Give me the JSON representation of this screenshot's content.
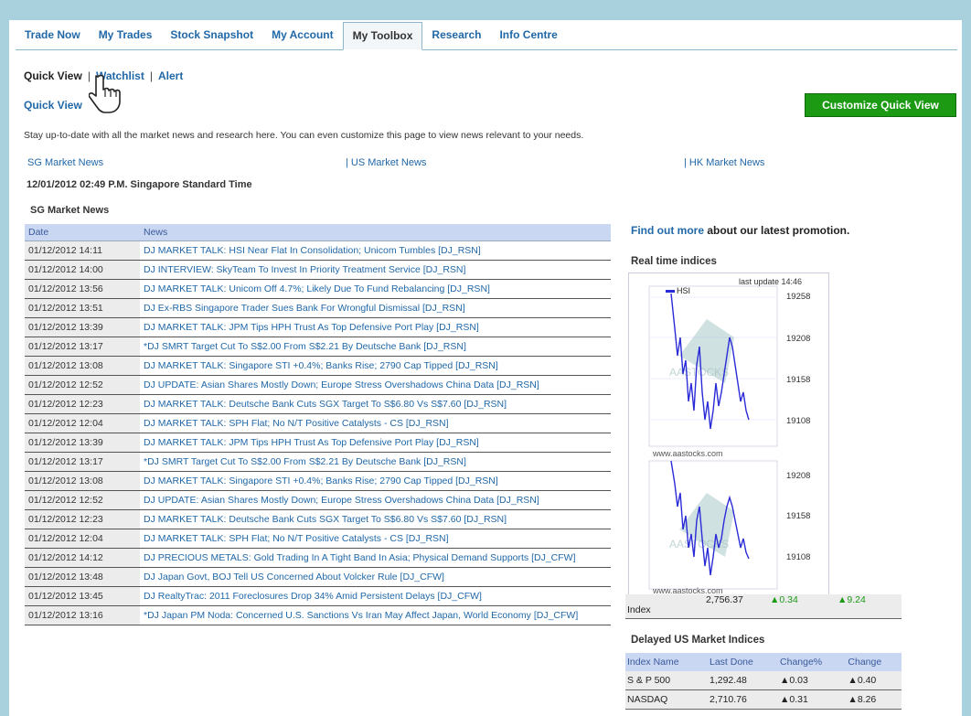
{
  "tabs": [
    {
      "label": "Trade Now"
    },
    {
      "label": "My Trades"
    },
    {
      "label": "Stock Snapshot"
    },
    {
      "label": "My Account"
    },
    {
      "label": "My Toolbox",
      "active": true
    },
    {
      "label": "Research"
    },
    {
      "label": "Info Centre"
    }
  ],
  "subnav": {
    "quick_view": "Quick View",
    "sep": "|",
    "watchlist": "Watchlist",
    "alert": "Alert"
  },
  "page_title": "Quick View",
  "customize_button": "Customize Quick View",
  "intro": "Stay up-to-date with all the market news and research here. You can even customize this page to view news relevant to your needs.",
  "market_links": {
    "sg": "SG Market News",
    "us": "| US Market News",
    "hk": "| HK Market News"
  },
  "timestamp": "12/01/2012 02:49 P.M. Singapore Standard Time",
  "section_label": "SG Market News",
  "news_table": {
    "headers": [
      "Date",
      "News"
    ],
    "rows": [
      [
        "01/12/2012 14:11",
        "DJ MARKET TALK: HSI Near Flat In Consolidation; Unicom Tumbles [DJ_RSN]"
      ],
      [
        "01/12/2012 14:00",
        "DJ INTERVIEW: SkyTeam To Invest In Priority Treatment Service [DJ_RSN]"
      ],
      [
        "01/12/2012 13:56",
        "DJ MARKET TALK: Unicom Off 4.7%; Likely Due To Fund Rebalancing [DJ_RSN]"
      ],
      [
        "01/12/2012 13:51",
        "DJ Ex-RBS Singapore Trader Sues Bank For Wrongful Dismissal [DJ_RSN]"
      ],
      [
        "01/12/2012 13:39",
        "DJ MARKET TALK: JPM Tips HPH Trust As Top Defensive Port Play [DJ_RSN]"
      ],
      [
        "01/12/2012 13:17",
        "*DJ SMRT Target Cut To S$2.00 From S$2.21 By Deutsche Bank [DJ_RSN]"
      ],
      [
        "01/12/2012 13:08",
        "DJ MARKET TALK: Singapore STI +0.4%; Banks Rise; 2790 Cap Tipped [DJ_RSN]"
      ],
      [
        "01/12/2012 12:52",
        "DJ UPDATE: Asian Shares Mostly Down; Europe Stress Overshadows China Data [DJ_RSN]"
      ],
      [
        "01/12/2012 12:23",
        "DJ MARKET TALK: Deutsche Bank Cuts SGX Target To S$6.80 Vs S$7.60 [DJ_RSN]"
      ],
      [
        "01/12/2012 12:04",
        "DJ MARKET TALK: SPH Flat; No N/T Positive Catalysts - CS [DJ_RSN]"
      ],
      [
        "01/12/2012 13:39",
        "DJ MARKET TALK: JPM Tips HPH Trust As Top Defensive Port Play [DJ_RSN]"
      ],
      [
        "01/12/2012 13:17",
        "*DJ SMRT Target Cut To S$2.00 From S$2.21 By Deutsche Bank [DJ_RSN]"
      ],
      [
        "01/12/2012 13:08",
        "DJ MARKET TALK: Singapore STI +0.4%; Banks Rise; 2790 Cap Tipped [DJ_RSN]"
      ],
      [
        "01/12/2012 12:52",
        "DJ UPDATE: Asian Shares Mostly Down; Europe Stress Overshadows China Data [DJ_RSN]"
      ],
      [
        "01/12/2012 12:23",
        "DJ MARKET TALK: Deutsche Bank Cuts SGX Target To S$6.80 Vs S$7.60 [DJ_RSN]"
      ],
      [
        "01/12/2012 12:04",
        "DJ MARKET TALK: SPH Flat; No N/T Positive Catalysts - CS [DJ_RSN]"
      ],
      [
        "01/12/2012 14:12",
        "DJ PRECIOUS METALS: Gold Trading In A Tight Band In Asia; Physical Demand Supports [DJ_CFW]"
      ],
      [
        "01/12/2012 13:48",
        "DJ Japan Govt, BOJ Tell US Concerned About Volcker Rule [DJ_CFW]"
      ],
      [
        "01/12/2012 13:45",
        "DJ RealtyTrac: 2011 Foreclosures Drop 34% Amid Persistent Delays [DJ_CFW]"
      ],
      [
        "01/12/2012 13:16",
        "*DJ Japan PM Noda: Concerned U.S. Sanctions Vs Iran May Affect Japan, World Economy [DJ_CFW]"
      ]
    ]
  },
  "promo": {
    "link": "Find out more",
    "rest": " about our latest promotion."
  },
  "realtime_label": "Real time indices",
  "chart": {
    "last_update": "last update 14:46",
    "legend": "HSI",
    "watermark": "AASTOCKS",
    "site": "www.aastocks.com",
    "ticks_top": [
      "19258",
      "19208",
      "19158",
      "19108"
    ],
    "ticks_bottom": [
      "19208",
      "19158",
      "19108"
    ],
    "line_color": "#2b2bd8"
  },
  "partial_index_row": {
    "name": "Index",
    "last": "2,756.37",
    "pct": "▲0.34",
    "chg": "▲9.24"
  },
  "delayed_label": "Delayed US Market Indices",
  "us_table": {
    "headers": [
      "Index Name",
      "Last Done",
      "Change%",
      "Change"
    ],
    "rows": [
      [
        "S & P 500",
        "1,292.48",
        "▲0.03",
        "▲0.40"
      ],
      [
        "NASDAQ",
        "2,710.76",
        "▲0.31",
        "▲8.26"
      ]
    ]
  }
}
